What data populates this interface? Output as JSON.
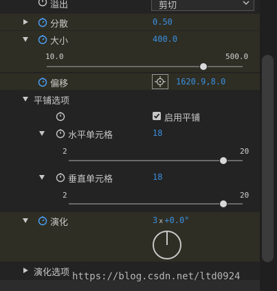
{
  "rows": {
    "overflow": {
      "label": "溢出",
      "value": "剪切"
    },
    "scatter": {
      "label": "分散",
      "value": "0.50"
    },
    "size": {
      "label": "大小",
      "value": "400.0",
      "min": "10.0",
      "max": "500.0",
      "level": 0.8
    },
    "offset": {
      "label": "偏移",
      "value": "1620.9,8.0"
    },
    "tile_options": {
      "label": "平铺选项"
    },
    "enable_tile": {
      "label": "启用平铺",
      "checked": true
    },
    "h_cells": {
      "label": "水平单元格",
      "value": "18",
      "min": "2",
      "max": "20",
      "level": 0.89
    },
    "v_cells": {
      "label": "垂直单元格",
      "value": "18",
      "min": "2",
      "max": "20",
      "level": 0.89
    },
    "evolution": {
      "label": "演化",
      "value_revs": "3",
      "value_x": "x",
      "value_deg": "+0.0°"
    },
    "evolution_options": {
      "label": "演化选项"
    }
  },
  "watermark": "https://blog.csdn.net/ltd0924",
  "colors": {
    "value_blue": "#3a8fe0",
    "stopwatch_blue": "#4aa3ff",
    "selected_row": "#2f2e24"
  }
}
